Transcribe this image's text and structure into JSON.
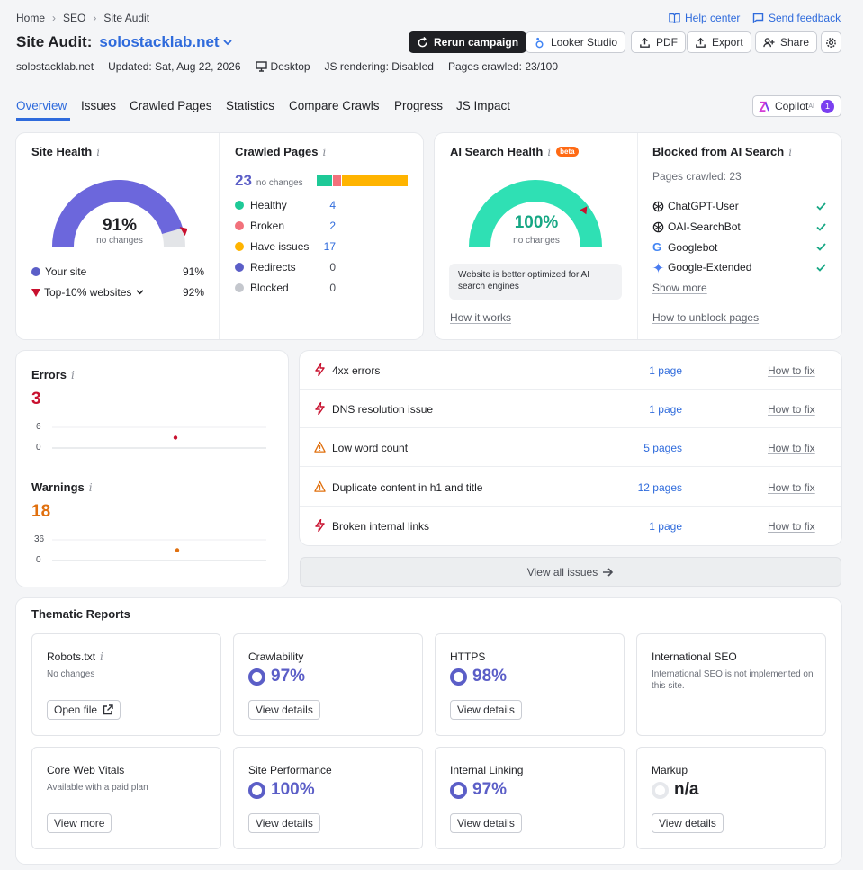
{
  "breadcrumb": [
    "Home",
    "SEO",
    "Site Audit"
  ],
  "header": {
    "help_center": "Help center",
    "send_feedback": "Send feedback",
    "title_prefix": "Site Audit:",
    "domain": "solostacklab.net",
    "rerun": "Rerun campaign",
    "looker": "Looker Studio",
    "pdf": "PDF",
    "export": "Export",
    "share": "Share"
  },
  "meta": {
    "site": "solostacklab.net",
    "updated": "Updated: Sat, Aug 22, 2026",
    "device": "Desktop",
    "js": "JS rendering: Disabled",
    "crawled": "Pages crawled: 23/100"
  },
  "tabs": [
    "Overview",
    "Issues",
    "Crawled Pages",
    "Statistics",
    "Compare Crawls",
    "Progress",
    "JS Impact"
  ],
  "copilot": {
    "label": "Copilot",
    "sup": "AI",
    "count": "1"
  },
  "site_health": {
    "title": "Site Health",
    "value": "91%",
    "sub": "no changes",
    "fill": 0.91,
    "your_site_label": "Your site",
    "your_site_value": "91%",
    "top_label": "Top-10% websites",
    "top_value": "92%"
  },
  "crawled_pages": {
    "title": "Crawled Pages",
    "total": "23",
    "sub": "no changes",
    "items": [
      {
        "label": "Healthy",
        "value": "4",
        "color": "#1ec997"
      },
      {
        "label": "Broken",
        "value": "2",
        "color": "#f2717b"
      },
      {
        "label": "Have issues",
        "value": "17",
        "color": "#ffb400"
      },
      {
        "label": "Redirects",
        "value": "0",
        "color": "#5b5ec7"
      },
      {
        "label": "Blocked",
        "value": "0",
        "color": "#c4c7cd"
      }
    ]
  },
  "ai_health": {
    "title": "AI Search Health",
    "badge": "beta",
    "value": "100%",
    "sub": "no changes",
    "note": "Website is better optimized for AI search engines",
    "link": "How it works"
  },
  "blocked_ai": {
    "title": "Blocked from AI Search",
    "sub": "Pages crawled: 23",
    "bots": [
      "ChatGPT-User",
      "OAI-SearchBot",
      "Googlebot",
      "Google-Extended"
    ],
    "show_more": "Show more",
    "link": "How to unblock pages"
  },
  "errors": {
    "title": "Errors",
    "value": "3",
    "y_top": "6",
    "y_bottom": "0"
  },
  "warnings": {
    "title": "Warnings",
    "value": "18",
    "y_top": "36",
    "y_bottom": "0"
  },
  "issues": [
    {
      "type": "error",
      "title": "4xx errors",
      "count": "1 page",
      "fix": "How to fix"
    },
    {
      "type": "error",
      "title": "DNS resolution issue",
      "count": "1 page",
      "fix": "How to fix"
    },
    {
      "type": "warning",
      "title": "Low word count",
      "count": "5 pages",
      "fix": "How to fix"
    },
    {
      "type": "warning",
      "title": "Duplicate content in h1 and title",
      "count": "12 pages",
      "fix": "How to fix"
    },
    {
      "type": "error",
      "title": "Broken internal links",
      "count": "1 page",
      "fix": "How to fix"
    }
  ],
  "view_all": "View all issues",
  "thematic": {
    "title": "Thematic Reports",
    "reports": [
      {
        "name": "Robots.txt",
        "sub": "No changes",
        "button": "Open file"
      },
      {
        "name": "Crawlability",
        "pct": "97%",
        "button": "View details"
      },
      {
        "name": "HTTPS",
        "pct": "98%",
        "button": "View details"
      },
      {
        "name": "International SEO",
        "sub": "International SEO is not implemented on this site."
      },
      {
        "name": "Core Web Vitals",
        "sub": "Available with a paid plan",
        "button": "View more"
      },
      {
        "name": "Site Performance",
        "pct": "100%",
        "button": "View details"
      },
      {
        "name": "Internal Linking",
        "pct": "97%",
        "button": "View details"
      },
      {
        "name": "Markup",
        "pct": "n/a",
        "button": "View details"
      }
    ]
  },
  "colors": {
    "accent": "#2f6bdc",
    "purple": "#5b5ec7",
    "teal": "#2fe0b4",
    "error": "#c8102e",
    "warning": "#e0700f"
  }
}
